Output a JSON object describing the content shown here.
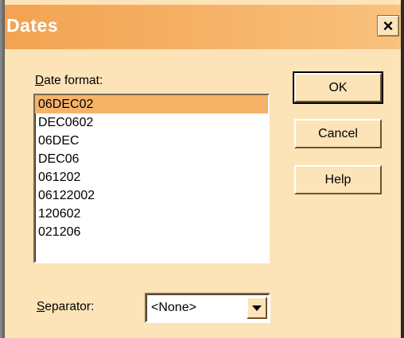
{
  "window": {
    "title": "Dates",
    "close_glyph": "×"
  },
  "date_format": {
    "label_accel": "D",
    "label_rest": "ate format:",
    "items": [
      "06DEC02",
      "DEC0602",
      "06DEC",
      "DEC06",
      "061202",
      "06122002",
      "120602",
      "021206"
    ],
    "selected_index": 0
  },
  "separator": {
    "label_accel": "S",
    "label_rest": "eparator:",
    "value": "<None>"
  },
  "buttons": {
    "ok": "OK",
    "cancel": "Cancel",
    "help": "Help"
  },
  "colors": {
    "dialog_bg": "#fde3b8",
    "title_bar": "#f6b368",
    "selection": "#f6b368"
  }
}
